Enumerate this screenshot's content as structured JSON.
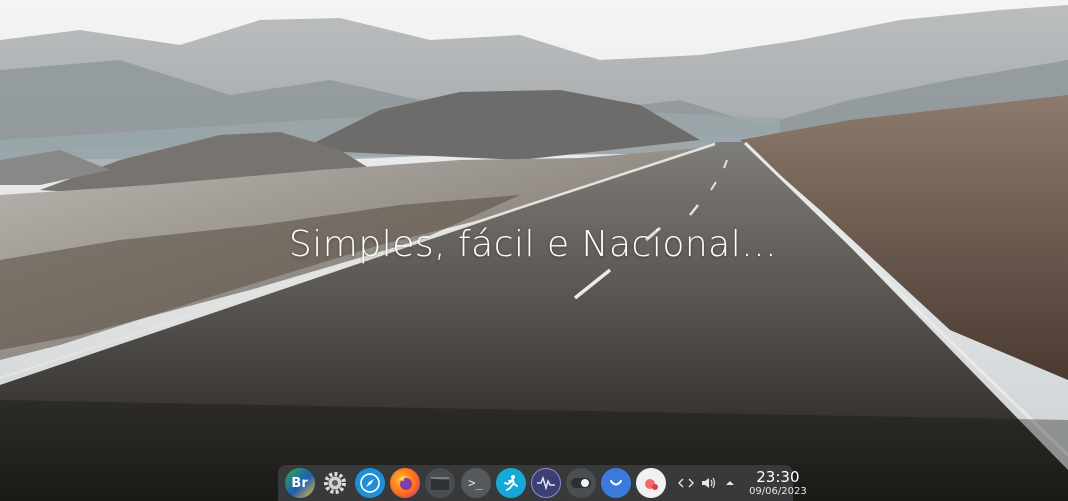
{
  "desktop": {
    "tagline": "Simples, fácil e Nacional..."
  },
  "taskbar": {
    "launchers": [
      {
        "name": "bigcommunity-launcher",
        "icon": "br-globe-icon",
        "label": "Br"
      },
      {
        "name": "settings-launcher",
        "icon": "gear-icon"
      },
      {
        "name": "browser-launcher",
        "icon": "compass-icon"
      },
      {
        "name": "firefox-launcher",
        "icon": "firefox-icon"
      },
      {
        "name": "file-manager-launcher",
        "icon": "folder-icon"
      },
      {
        "name": "terminal-launcher",
        "icon": "terminal-icon",
        "label": ">_"
      },
      {
        "name": "install-launcher",
        "icon": "runner-icon"
      },
      {
        "name": "system-monitor-launcher",
        "icon": "waveform-icon"
      },
      {
        "name": "toggle-launcher",
        "icon": "toggle-icon"
      },
      {
        "name": "store-launcher",
        "icon": "bag-icon"
      },
      {
        "name": "screenshot-launcher",
        "icon": "camera-icon"
      }
    ],
    "tray": {
      "network_icon": "network-arrows-icon",
      "volume_icon": "speaker-icon",
      "expand_icon": "caret-up-icon"
    },
    "clock": {
      "time": "23:30",
      "date": "09/06/2023"
    }
  },
  "colors": {
    "taskbar_bg": "#3a3c3e",
    "sky": "#e9eaea",
    "road": "#3e3b37",
    "text": "#ffffff"
  }
}
